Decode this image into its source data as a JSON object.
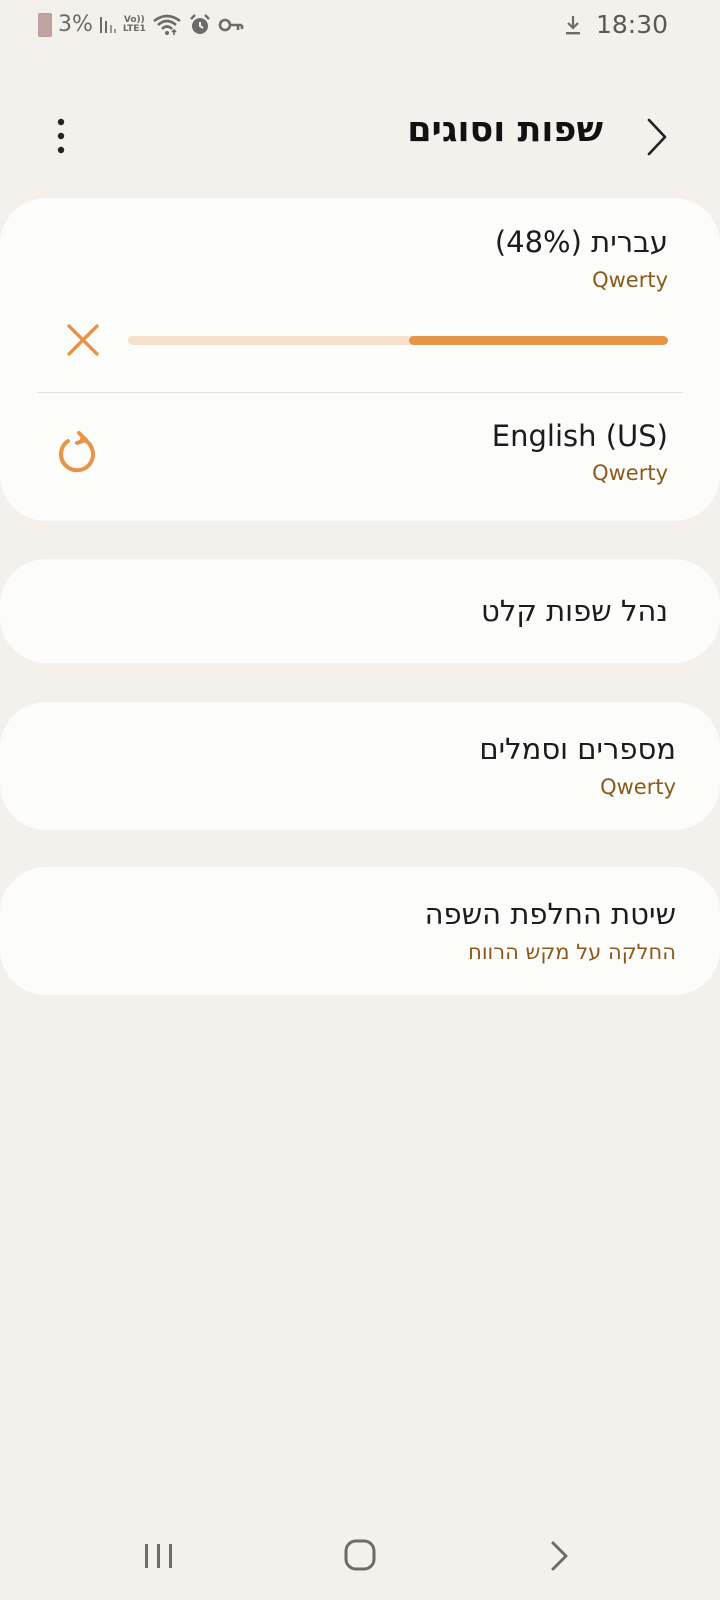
{
  "status_bar": {
    "battery_percent": "3%",
    "time": "18:30",
    "volte_label": "Vo))\nLTE1",
    "icons": [
      "battery-icon",
      "signal-icon",
      "volte-icon",
      "wifi-icon",
      "alarm-icon",
      "key-icon",
      "download-icon"
    ]
  },
  "header": {
    "title": "שפות וסוגים",
    "icons": [
      "back-chevron-icon",
      "more-options-icon"
    ]
  },
  "languages": [
    {
      "name": "עברית (48%)",
      "layout": "Qwerty",
      "download_progress": 0.48,
      "action_icon": "cancel-icon"
    },
    {
      "name": "English (US)",
      "layout": "Qwerty",
      "action_icon": "refresh-icon"
    }
  ],
  "manage_languages": {
    "label": "נהל שפות קלט"
  },
  "numbers_symbols": {
    "label": "מספרים וסמלים",
    "value": "Qwerty"
  },
  "language_switching": {
    "label": "שיטת החלפת השפה",
    "value": "החלקה על מקש הרווח"
  },
  "nav_bar": {
    "icons": [
      "recents-icon",
      "home-icon",
      "back-icon"
    ]
  },
  "colors": {
    "background": "#f4f0ec",
    "card": "#fcfcfb",
    "accent": "#e69447",
    "accent_track": "#f6dfcb",
    "subtitle": "#8a5a1c"
  }
}
